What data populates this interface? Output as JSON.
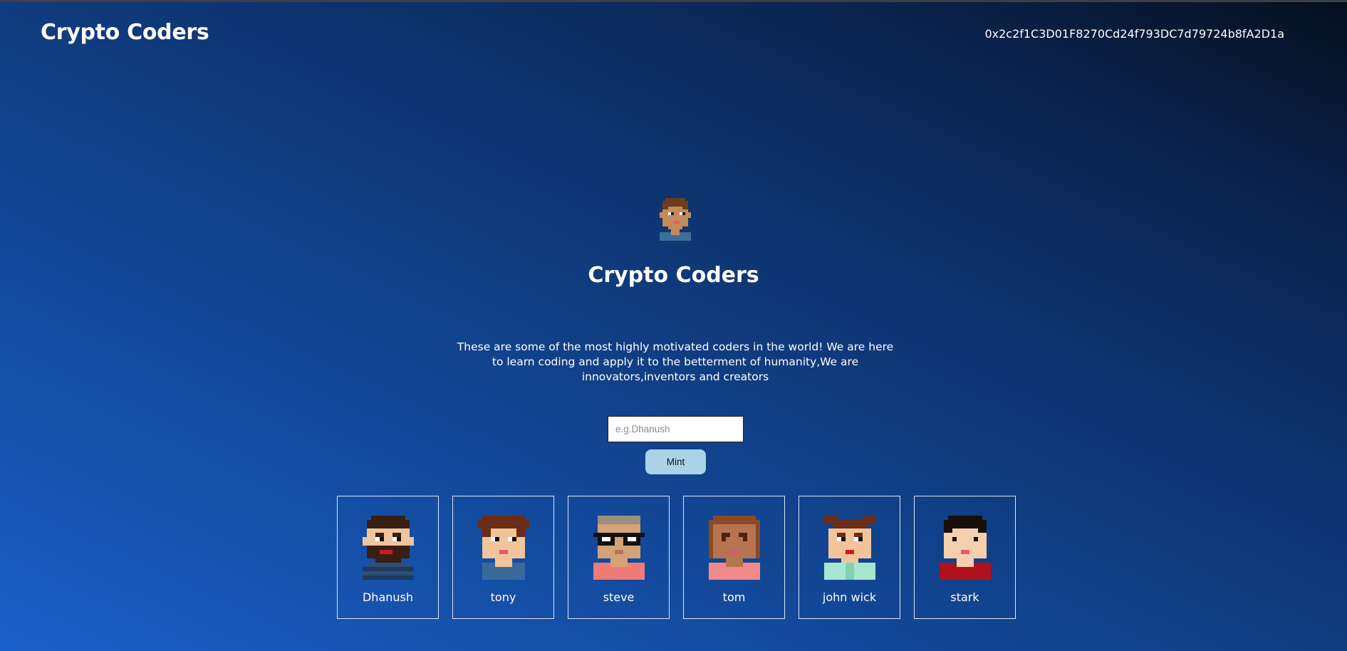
{
  "header": {
    "title": "Crypto Coders",
    "wallet_address": "0x2c2f1C3D01F8270Cd24f793DC7d79724b8fA2D1a"
  },
  "hero": {
    "avatar_icon": "pixel-coder-avatar-icon",
    "title": "Crypto Coders",
    "description": "These are some of the most highly motivated coders in the world! We are here to learn coding and apply it to the betterment of humanity,We are innovators,inventors and creators"
  },
  "mint_form": {
    "name_input": {
      "value": "",
      "placeholder": "e.g.Dhanush"
    },
    "mint_label": "Mint"
  },
  "coders": [
    {
      "name": "Dhanush",
      "icon": "pixel-avatar-bearded-icon"
    },
    {
      "name": "tony",
      "icon": "pixel-avatar-brown-hair-icon"
    },
    {
      "name": "steve",
      "icon": "pixel-avatar-glasses-icon"
    },
    {
      "name": "tom",
      "icon": "pixel-avatar-curly-hair-icon"
    },
    {
      "name": "john wick",
      "icon": "pixel-avatar-pigtails-icon"
    },
    {
      "name": "stark",
      "icon": "pixel-avatar-black-hair-icon"
    }
  ],
  "colors": {
    "background_start": "#1a5fc8",
    "background_end": "#05101f",
    "mint_button": "#a9d3e6",
    "card_border": "#dfe6f5"
  }
}
